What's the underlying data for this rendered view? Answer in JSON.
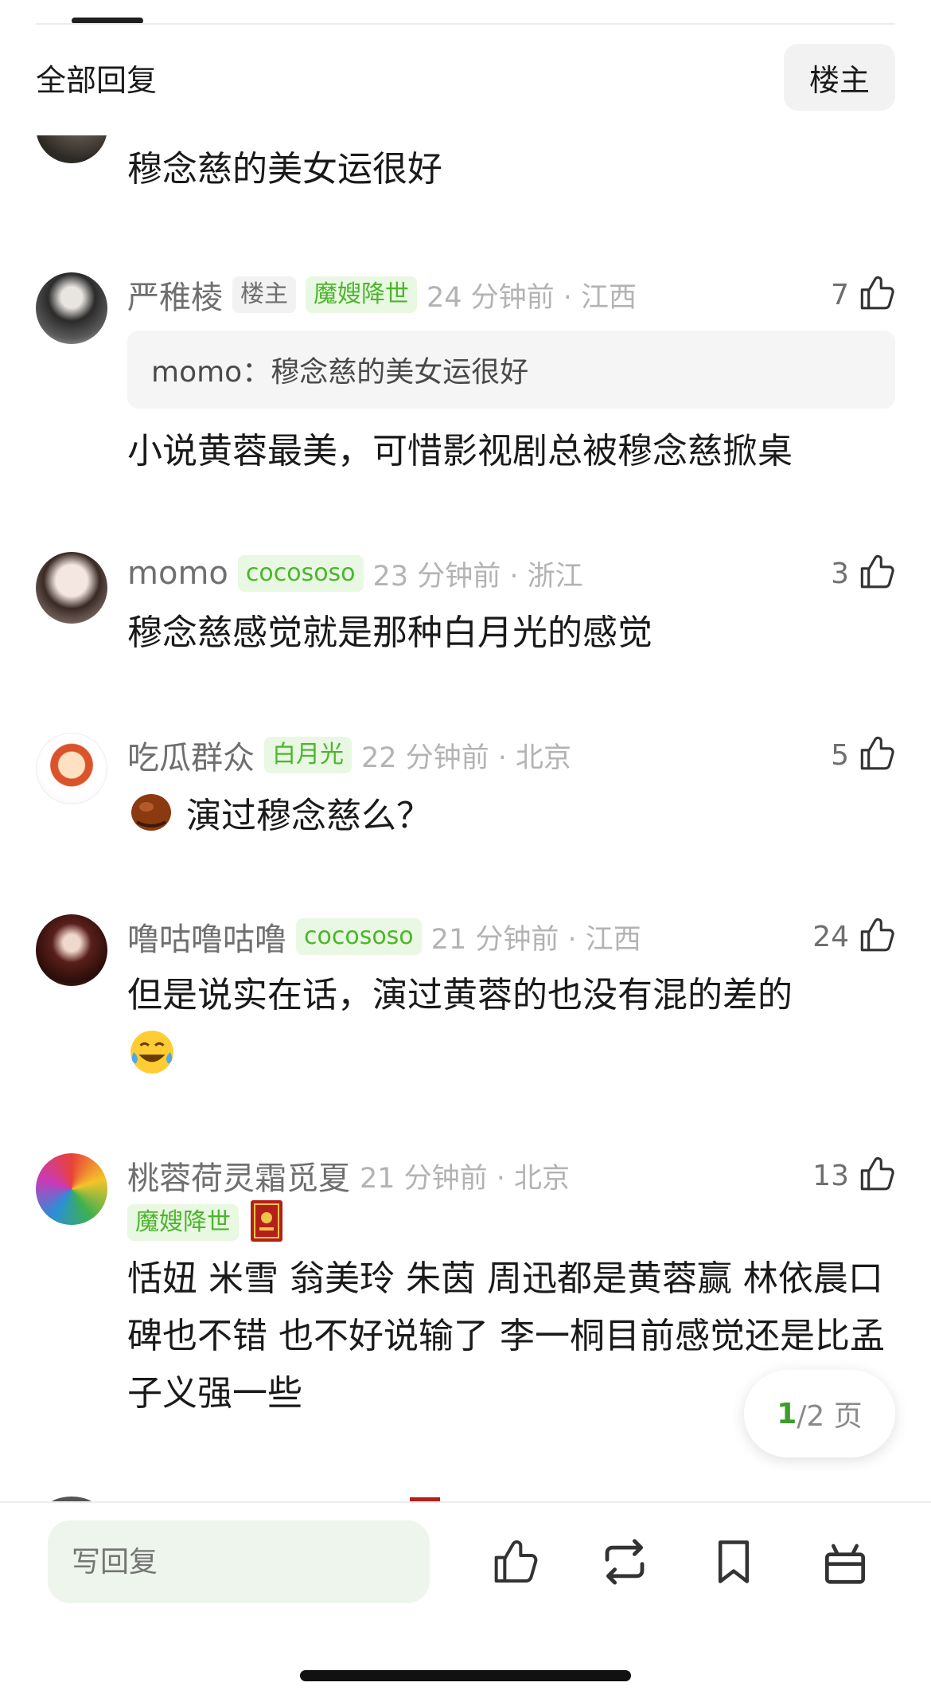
{
  "header": {
    "title": "全部回复",
    "filter_label": "楼主"
  },
  "comments": [
    {
      "name": "",
      "text": "穆念慈的美女运很好"
    },
    {
      "name": "严稚棱",
      "tags": [
        "楼主",
        "魔嫂降世"
      ],
      "meta": "24 分钟前 · 江西",
      "likes": "7",
      "quote": "momo：穆念慈的美女运很好",
      "text": "小说黄蓉最美，可惜影视剧总被穆念慈掀桌"
    },
    {
      "name": "momo",
      "tags": [
        "cocososo"
      ],
      "meta": "23 分钟前 · 浙江",
      "likes": "3",
      "text": "穆念慈感觉就是那种白月光的感觉"
    },
    {
      "name": "吃瓜群众",
      "tags": [
        "白月光"
      ],
      "meta": "22 分钟前 · 北京",
      "likes": "5",
      "text": "演过穆念慈么？",
      "emoji": "chestnut-emoji"
    },
    {
      "name": "噜咕噜咕噜",
      "tags": [
        "cocososo"
      ],
      "meta": "21 分钟前 · 江西",
      "likes": "24",
      "text": "但是说实在话，演过黄蓉的也没有混的差的",
      "emoji": "tears-of-joy-emoji"
    },
    {
      "name": "桃蓉荷灵霜觅夏",
      "tags": [
        "魔嫂降世"
      ],
      "meta": "21 分钟前 · 北京",
      "likes": "13",
      "text": "恬妞 米雪 翁美玲 朱茵 周迅都是黄蓉赢 林依晨口碑也不错 也不好说输了 李一桐目前感觉还是比孟子义强一些",
      "badge_icon": "red-book-badge-icon"
    }
  ],
  "pager": {
    "current": "1",
    "rest": "/2 页"
  },
  "bottom_bar": {
    "reply_placeholder": "写回复",
    "icons": [
      "like-icon",
      "repost-icon",
      "bookmark-icon",
      "gift-icon"
    ]
  },
  "colors": {
    "tag_green_bg": "#e9f8e2",
    "tag_green_fg": "#4cb52e",
    "pager_current": "#3b9e2a",
    "reply_bg": "#eef5ec"
  }
}
